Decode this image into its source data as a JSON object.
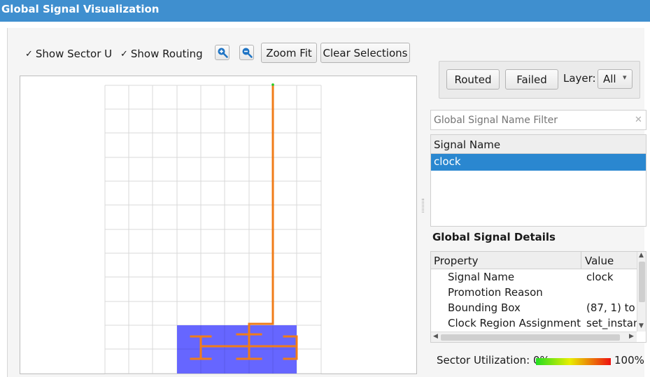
{
  "window": {
    "title": "Global Signal Visualization"
  },
  "toolbar": {
    "show_sector_label": "Show Sector U",
    "show_sector_checked": true,
    "show_routing_label": "Show Routing",
    "show_routing_checked": true,
    "check_glyph": "✓",
    "zoom_in_icon": "zoom-in-icon",
    "zoom_out_icon": "zoom-out-icon",
    "zoom_fit_label": "Zoom Fit",
    "clear_selections_label": "Clear Selections"
  },
  "filters": {
    "routed_label": "Routed",
    "failed_label": "Failed",
    "layer_label": "Layer:",
    "layer_value": "All",
    "layer_arrow": "▾"
  },
  "signal_filter": {
    "placeholder": "Global Signal Name Filter",
    "clear_glyph": "✕"
  },
  "signal_list": {
    "header": "Signal Name",
    "items": [
      {
        "name": "clock",
        "selected": true
      }
    ]
  },
  "details": {
    "title": "Global Signal Details",
    "col_property": "Property",
    "col_value": "Value",
    "rows": [
      {
        "property": "Signal Name",
        "value": "clock"
      },
      {
        "property": "Promotion Reason",
        "value": ""
      },
      {
        "property": "Bounding Box",
        "value": "(87, 1) to ("
      },
      {
        "property": "Clock Region Assignment",
        "value": "set_instan"
      }
    ]
  },
  "utilization": {
    "label": "Sector Utilization: 0%",
    "max_label": "100%"
  },
  "colors": {
    "title_bar": "#3f8fcf",
    "selection": "#2a87d0",
    "routing": "#f07c19",
    "sector_fill": "#6666ff",
    "grid": "#d9d9d9"
  }
}
